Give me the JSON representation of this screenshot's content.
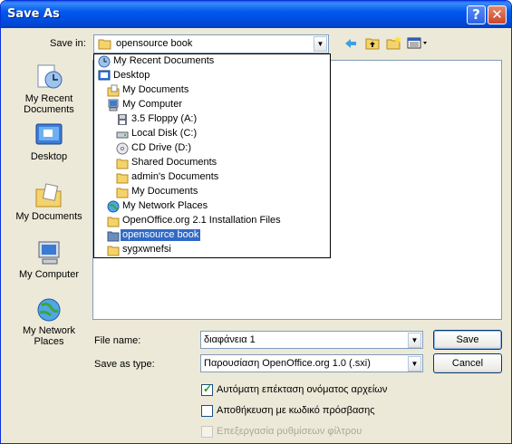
{
  "window": {
    "title": "Save As",
    "help_label": "?",
    "close_label": "✕"
  },
  "save_in": {
    "label": "Save in:",
    "value": "opensource book",
    "items": [
      {
        "label": "My Recent Documents",
        "icon": "recent-documents-icon",
        "indent": 0
      },
      {
        "label": "Desktop",
        "icon": "desktop-icon",
        "indent": 0
      },
      {
        "label": "My Documents",
        "icon": "my-documents-icon",
        "indent": 1
      },
      {
        "label": "My Computer",
        "icon": "my-computer-icon",
        "indent": 1
      },
      {
        "label": "3.5 Floppy (A:)",
        "icon": "floppy-drive-icon",
        "indent": 2
      },
      {
        "label": "Local Disk (C:)",
        "icon": "hard-disk-icon",
        "indent": 2
      },
      {
        "label": "CD Drive (D:)",
        "icon": "cd-drive-icon",
        "indent": 2
      },
      {
        "label": "Shared Documents",
        "icon": "folder-icon",
        "indent": 2
      },
      {
        "label": "admin's Documents",
        "icon": "folder-icon",
        "indent": 2
      },
      {
        "label": "My Documents",
        "icon": "folder-icon",
        "indent": 2
      },
      {
        "label": "My Network Places",
        "icon": "network-places-icon",
        "indent": 1
      },
      {
        "label": "OpenOffice.org 2.1 Installation Files",
        "icon": "folder-icon",
        "indent": 1
      },
      {
        "label": "opensource book",
        "icon": "open-folder-icon",
        "indent": 1,
        "selected": true
      },
      {
        "label": "sygxwnefsi",
        "icon": "folder-icon",
        "indent": 1
      }
    ]
  },
  "toolbar": [
    "back-icon",
    "up-folder-icon",
    "new-folder-icon",
    "views-menu-icon"
  ],
  "places": [
    {
      "label": "My Recent\nDocuments",
      "icon": "recent-documents-icon"
    },
    {
      "label": "Desktop",
      "icon": "desktop-icon"
    },
    {
      "label": "My Documents",
      "icon": "my-documents-icon"
    },
    {
      "label": "My Computer",
      "icon": "my-computer-icon"
    },
    {
      "label": "My Network\nPlaces",
      "icon": "network-places-icon"
    }
  ],
  "file_name": {
    "label": "File name:",
    "value": "διαφάνεια 1"
  },
  "save_as_type": {
    "label": "Save as type:",
    "value": "Παρουσίαση OpenOffice.org 1.0 (.sxi)"
  },
  "buttons": {
    "save": "Save",
    "cancel": "Cancel"
  },
  "options": [
    {
      "label": "Αυτόματη επέκταση ονόματος αρχείων",
      "checked": true,
      "enabled": true
    },
    {
      "label": "Αποθήκευση με κωδικό πρόσβασης",
      "checked": false,
      "enabled": true
    },
    {
      "label": "Επεξεργασία ρυθμίσεων φίλτρου",
      "checked": false,
      "enabled": false
    }
  ],
  "colors": {
    "titlebar": "#0058EE",
    "selection": "#316AC5",
    "dialog_bg": "#ECE9D8"
  }
}
